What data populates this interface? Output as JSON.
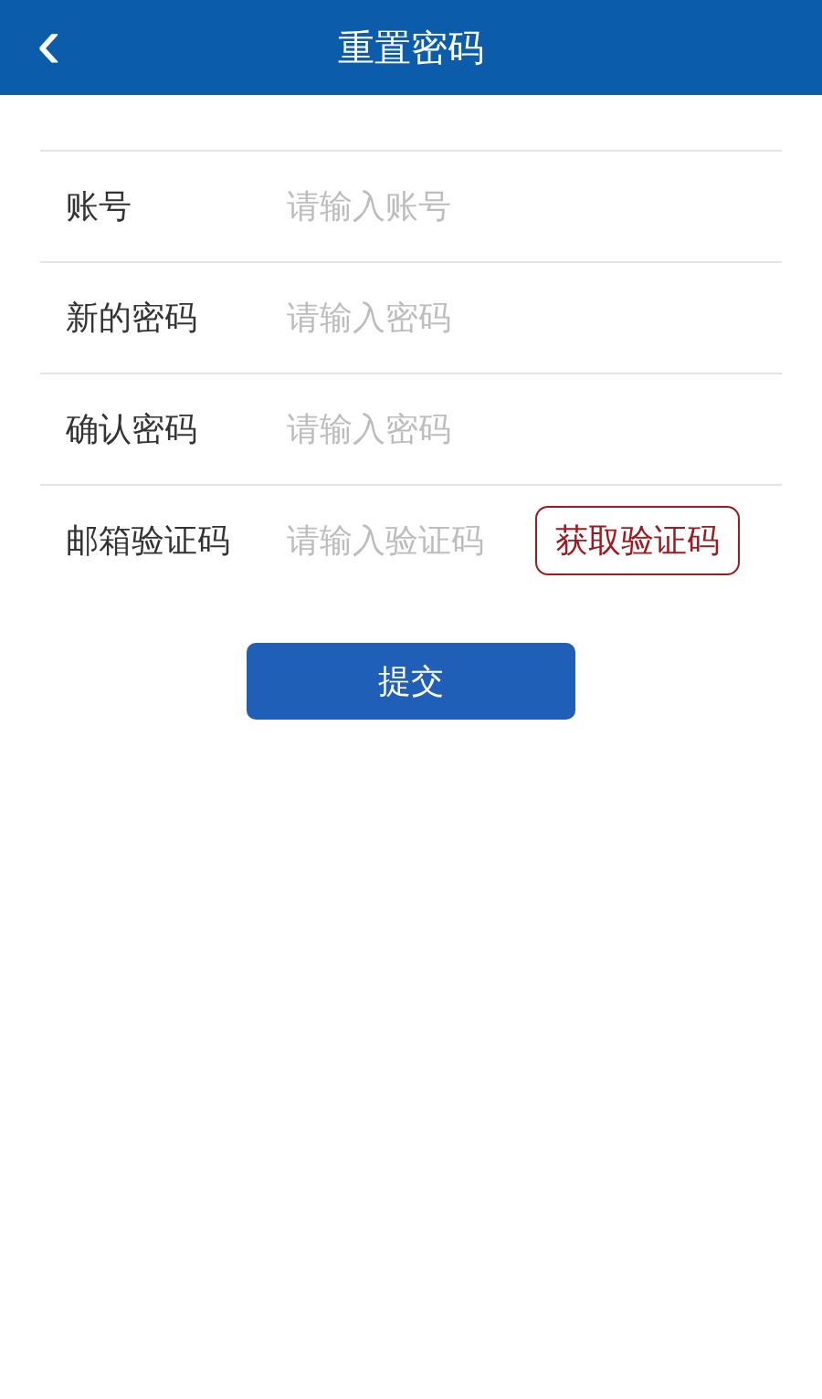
{
  "header": {
    "back": "‹",
    "title": "重置密码"
  },
  "fields": [
    {
      "kind": "text",
      "label": "账号",
      "placeholder": "请输入账号"
    },
    {
      "kind": "text",
      "label": "新的密码",
      "placeholder": "请输入密码"
    },
    {
      "kind": "text",
      "label": "确认密码",
      "placeholder": "请输入密码"
    },
    {
      "kind": "code",
      "label": "邮箱验证码",
      "placeholder": "请输入验证码",
      "button": "获取验证码"
    }
  ],
  "submit": "提交"
}
